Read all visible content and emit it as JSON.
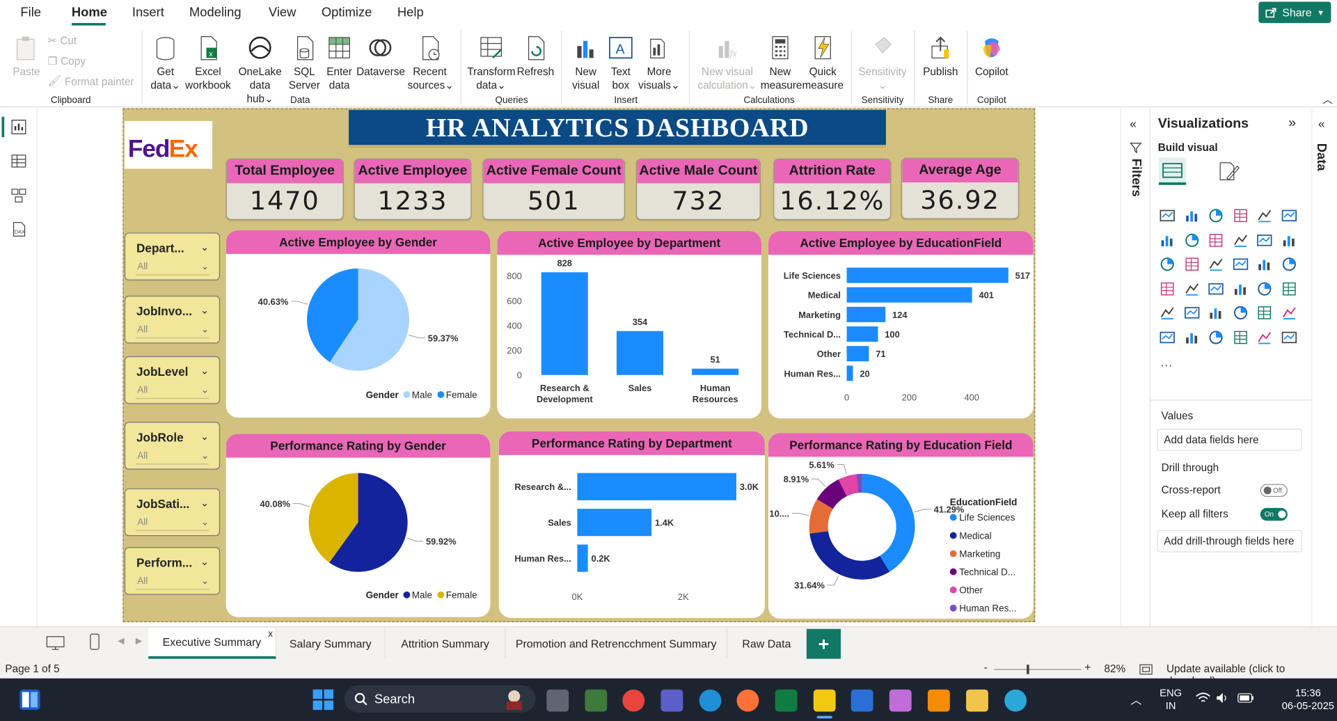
{
  "menu": {
    "items": [
      "File",
      "Home",
      "Insert",
      "Modeling",
      "View",
      "Optimize",
      "Help"
    ],
    "share_label": "Share"
  },
  "ribbon": {
    "clipboard": {
      "paste": "Paste",
      "cut": "Cut",
      "copy": "Copy",
      "format_painter": "Format painter",
      "group": "Clipboard"
    },
    "data": {
      "get_data": [
        "Get",
        "data"
      ],
      "excel": [
        "Excel",
        "workbook"
      ],
      "onelake": [
        "OneLake",
        "data hub"
      ],
      "sql": [
        "SQL",
        "Server"
      ],
      "enter": [
        "Enter",
        "data"
      ],
      "dataverse": "Dataverse",
      "recent": [
        "Recent",
        "sources"
      ],
      "group": "Data"
    },
    "queries": {
      "transform": [
        "Transform",
        "data"
      ],
      "refresh": "Refresh",
      "group": "Queries"
    },
    "insert": {
      "new_visual": [
        "New",
        "visual"
      ],
      "text_box": [
        "Text",
        "box"
      ],
      "more_visuals": [
        "More",
        "visuals"
      ],
      "group": "Insert"
    },
    "calculations": {
      "new_calc": [
        "New visual",
        "calculation"
      ],
      "new_measure": [
        "New",
        "measure"
      ],
      "quick_measure": [
        "Quick",
        "measure"
      ],
      "group": "Calculations"
    },
    "sensitivity": {
      "label": "Sensitivity",
      "group": "Sensitivity"
    },
    "share": {
      "publish": "Publish",
      "group": "Share"
    },
    "copilot": {
      "label": "Copilot",
      "group": "Copilot"
    }
  },
  "report": {
    "logo": {
      "fed": "Fed",
      "ex": "Ex"
    },
    "title": "HR ANALYTICS DASHBOARD",
    "kpis": [
      {
        "label": "Total Employee",
        "value": "1470"
      },
      {
        "label": "Active Employee",
        "value": "1233"
      },
      {
        "label": "Active Female Count",
        "value": "501"
      },
      {
        "label": "Active Male Count",
        "value": "732"
      },
      {
        "label": "Attrition Rate",
        "value": "16.12%"
      },
      {
        "label": "Average Age",
        "value": "36.92"
      }
    ],
    "slicers": [
      {
        "title": "Depart...",
        "value": "All"
      },
      {
        "title": "JobInvo...",
        "value": "All"
      },
      {
        "title": "JobLevel",
        "value": "All"
      },
      {
        "title": "JobRole",
        "value": "All"
      },
      {
        "title": "JobSati...",
        "value": "All"
      },
      {
        "title": "Perform...",
        "value": "All"
      }
    ],
    "cards": {
      "c1": "Active Employee by Gender",
      "c2": "Active Employee by Department",
      "c3": "Active Employee by EducationField",
      "c4": "Performance Rating by Gender",
      "c5": "Performance Rating by Department",
      "c6": "Performance Rating by Education Field"
    }
  },
  "chart_data": [
    {
      "type": "pie",
      "title": "Active Employee by Gender",
      "legend_title": "Gender",
      "legend_position": "bottom-right",
      "slices": [
        {
          "name": "Male",
          "value": 59.37,
          "label": "59.37%",
          "color": "#a8d4ff"
        },
        {
          "name": "Female",
          "value": 40.63,
          "label": "40.63%",
          "color": "#1a8cff"
        }
      ]
    },
    {
      "type": "bar",
      "title": "Active Employee by Department",
      "categories": [
        "Research & Development",
        "Sales",
        "Human Resources"
      ],
      "category_lines": [
        [
          "Research &",
          "Development"
        ],
        [
          "Sales"
        ],
        [
          "Human",
          "Resources"
        ]
      ],
      "values": [
        828,
        354,
        51
      ],
      "ylim": [
        0,
        900
      ],
      "yticks": [
        0,
        200,
        400,
        600,
        800
      ],
      "color": "#1a8cff"
    },
    {
      "type": "bar",
      "orientation": "horizontal",
      "title": "Active Employee by EducationField",
      "categories": [
        "Life Sciences",
        "Medical",
        "Marketing",
        "Technical D...",
        "Other",
        "Human Res..."
      ],
      "values": [
        517,
        401,
        124,
        100,
        71,
        20
      ],
      "xlim": [
        0,
        540
      ],
      "xticks": [
        0,
        200,
        400
      ],
      "color": "#1a8cff"
    },
    {
      "type": "pie",
      "title": "Performance Rating by Gender",
      "legend_title": "Gender",
      "legend_position": "bottom-right",
      "slices": [
        {
          "name": "Male",
          "value": 59.92,
          "label": "59.92%",
          "color": "#13239b"
        },
        {
          "name": "Female",
          "value": 40.08,
          "label": "40.08%",
          "color": "#dbb400"
        }
      ]
    },
    {
      "type": "bar",
      "orientation": "horizontal",
      "title": "Performance Rating by Department",
      "categories": [
        "Research &...",
        "Sales",
        "Human Res..."
      ],
      "values": [
        3000,
        1400,
        200
      ],
      "value_labels": [
        "3.0K",
        "1.4K",
        "0.2K"
      ],
      "xlim": [
        0,
        3200
      ],
      "xticks": [
        0,
        2000
      ],
      "xtick_labels": [
        "0K",
        "2K"
      ],
      "color": "#1a8cff"
    },
    {
      "type": "pie",
      "variant": "donut",
      "title": "Performance Rating by Education Field",
      "legend_title": "EducationField",
      "legend_position": "right",
      "slices": [
        {
          "name": "Life Sciences",
          "value": 41.29,
          "label": "41.29%",
          "color": "#1a8cff"
        },
        {
          "name": "Medical",
          "value": 31.64,
          "label": "31.64%",
          "color": "#13239b"
        },
        {
          "name": "Marketing",
          "value": 10.8,
          "label": "10....",
          "color": "#e66c37"
        },
        {
          "name": "Technical D...",
          "value": 8.91,
          "label": "8.91%",
          "color": "#6b007b"
        },
        {
          "name": "Other",
          "value": 5.61,
          "label": "5.61%",
          "color": "#e044a7"
        },
        {
          "name": "Human Res...",
          "value": 1.75,
          "label": "",
          "color": "#744ec2"
        }
      ]
    }
  ],
  "filters_label": "Filters",
  "viz_pane": {
    "title": "Visualizations",
    "build_visual": "Build visual",
    "values_label": "Values",
    "values_box": "Add data fields here",
    "drill_through": "Drill through",
    "cross_report": "Cross-report",
    "cross_report_state": "Off",
    "keep_filters": "Keep all filters",
    "keep_filters_state": "On",
    "drill_box": "Add drill-through fields here",
    "more": "..."
  },
  "data_label": "Data",
  "tabs": [
    "Executive Summary",
    "Salary Summary",
    "Attrition Summary",
    "Promotion and Retrencchment Summary",
    "Raw Data"
  ],
  "status": {
    "page": "Page 1 of 5",
    "zoom": "82%",
    "update": "Update available (click to download)"
  },
  "taskbar": {
    "search": "Search",
    "lang1": "ENG",
    "lang2": "IN",
    "time": "15:36",
    "date": "06-05-2025"
  }
}
